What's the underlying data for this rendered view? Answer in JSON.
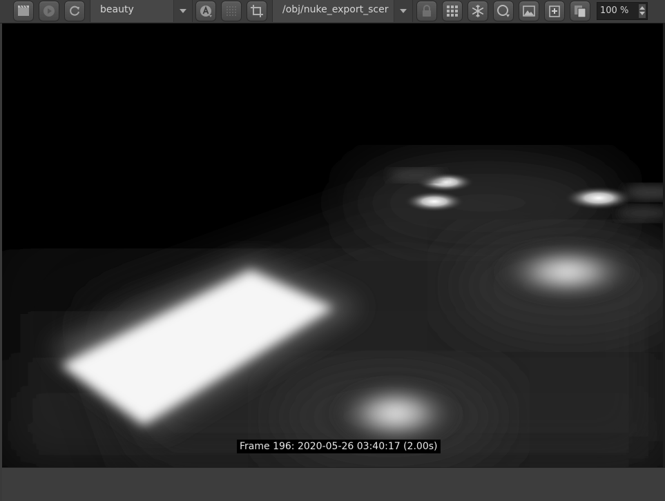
{
  "toolbar": {
    "buttons": [
      {
        "name": "render-region-icon"
      },
      {
        "name": "render-icon"
      },
      {
        "name": "refresh-icon"
      },
      {
        "name": "aov-label-icon"
      },
      {
        "name": "grid-dotted-icon"
      },
      {
        "name": "crop-icon"
      },
      {
        "name": "lock-icon"
      },
      {
        "name": "grid-icon"
      },
      {
        "name": "snowflake-icon"
      },
      {
        "name": "snapshot-icon"
      },
      {
        "name": "image-icon"
      },
      {
        "name": "add-icon"
      },
      {
        "name": "copy-icon"
      }
    ],
    "aov_value": "beauty",
    "camera_value": "/obj/nuke_export_scer",
    "zoom_value": "100 %"
  },
  "viewport": {
    "caption": "Frame 196: 2020-05-26 03:40:17 (2.00s)"
  }
}
